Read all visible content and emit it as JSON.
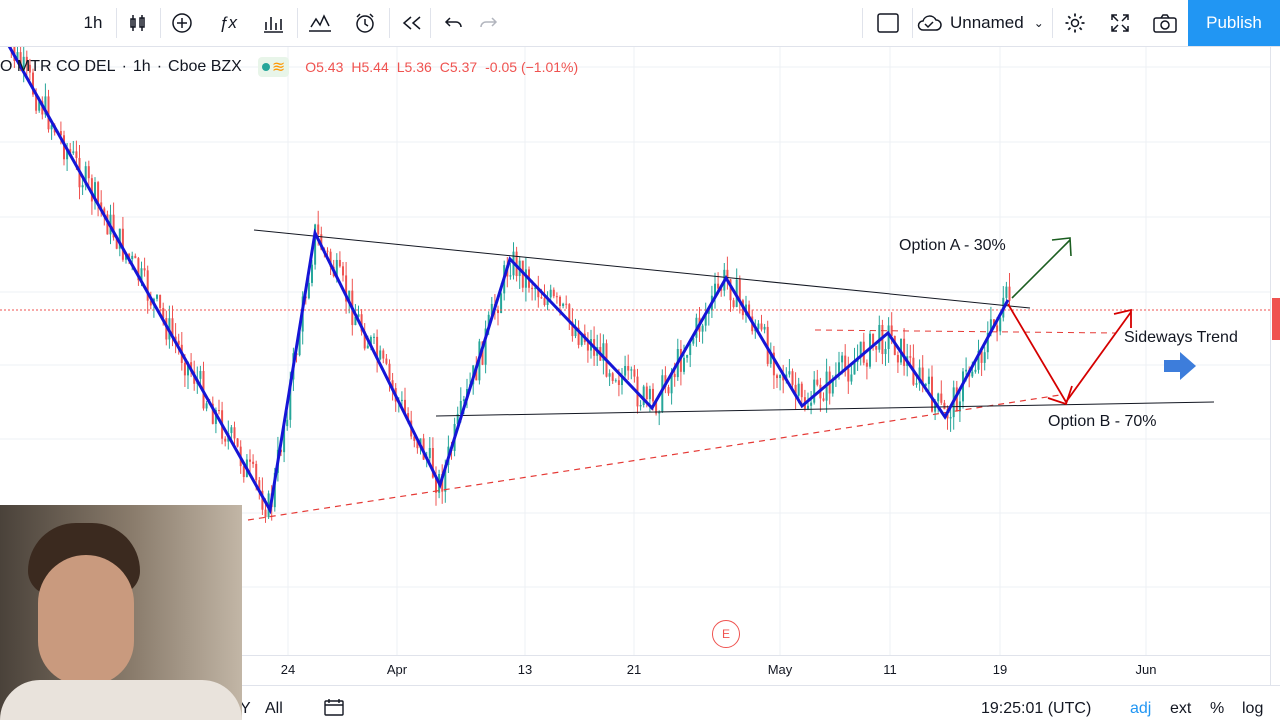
{
  "toolbar": {
    "interval": "1h",
    "layout_name": "Unnamed",
    "publish_label": "Publish",
    "icons": [
      "candles-icon",
      "add-indicator-icon",
      "fx-icon",
      "compare-icon",
      "indicators-icon",
      "alert-icon",
      "replay-icon",
      "undo-icon",
      "redo-icon",
      "layout-square-icon",
      "cloud-icon",
      "settings-icon",
      "fullscreen-icon",
      "camera-icon"
    ]
  },
  "legend": {
    "symbol": "O MTR CO DEL",
    "interval": "1h",
    "exchange": "Cboe BZX",
    "open": "O5.43",
    "high": "H5.44",
    "low": "L5.36",
    "close": "C5.37",
    "change": "-0.05 (−1.01%)",
    "colors": {
      "down": "#ef5350",
      "up": "#26a69a"
    }
  },
  "time_axis": {
    "labels": [
      "24",
      "Apr",
      "13",
      "21",
      "May",
      "11",
      "19",
      "Jun"
    ]
  },
  "annotations": {
    "option_a": "Option A - 30%",
    "option_b": "Option B - 70%",
    "sideways": "Sideways Trend",
    "earnings": "E"
  },
  "bottom_bar": {
    "range_fragment": "Y",
    "all": "All",
    "clock": "19:25:01 (UTC)",
    "adj": "adj",
    "ext": "ext",
    "percent": "%",
    "log": "log"
  },
  "chart_data": {
    "type": "candlestick",
    "title": "",
    "xlabel": "",
    "ylabel": "",
    "x_ticks": [
      "24",
      "Apr",
      "13",
      "21",
      "May",
      "11",
      "19",
      "Jun"
    ],
    "last_ohlc": {
      "open": 5.43,
      "high": 5.44,
      "low": 5.36,
      "close": 5.37,
      "change": -0.05,
      "change_pct": -1.01
    },
    "grid": true,
    "overlays": [
      "symmetrical triangle trendlines",
      "blue zigzag swing line",
      "Option A breakout up arrow",
      "Option B breakdown arrow",
      "sideways trend arrow"
    ],
    "colors": {
      "zigzag": "#1515d6",
      "trendline": "#131722",
      "support_dashed": "#e53935",
      "option_a_arrow": "#1b5e20",
      "option_b_arrow": "#d50000",
      "sideways_arrow": "#3d7ddb"
    }
  }
}
